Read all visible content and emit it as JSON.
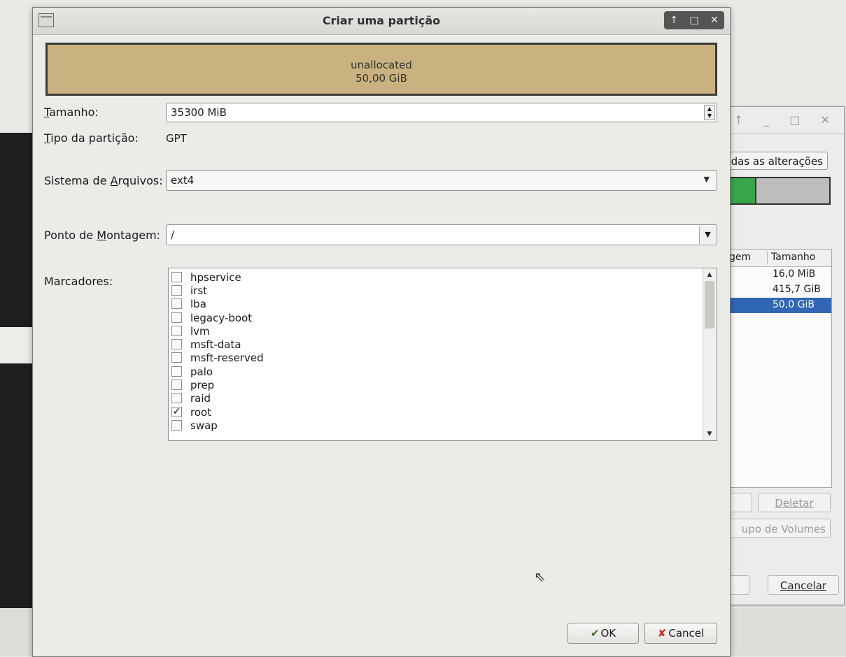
{
  "background_window": {
    "apply_all_label": "odas as alterações",
    "table_headers": [
      "gem",
      "Tamanho"
    ],
    "rows": [
      {
        "size": "16,0 MiB",
        "selected": false
      },
      {
        "size": "415,7 GiB",
        "selected": false
      },
      {
        "size": "50,0 GiB",
        "selected": true
      }
    ],
    "delete_label": "Deletar",
    "volume_group_label": "upo de Volumes",
    "cancel_label": "Cancelar"
  },
  "dialog": {
    "title": "Criar uma partição",
    "partition_bar": {
      "line1": "unallocated",
      "line2": "50,00 GiB",
      "color": "#c9b27f"
    },
    "size": {
      "label_mnemonic": "T",
      "label_rest": "amanho:",
      "value": "35300 MiB"
    },
    "partition_type": {
      "label_mnemonic": "T",
      "label_rest": "ipo da partição:",
      "value": "GPT"
    },
    "filesystem": {
      "label_pre": "Sistema de ",
      "label_mnemonic": "A",
      "label_rest": "rquivos:",
      "value": "ext4"
    },
    "mount_point": {
      "label_pre": "Ponto de ",
      "label_mnemonic": "M",
      "label_rest": "ontagem:",
      "value": "/"
    },
    "flags_label": "Marcadores:",
    "flags": [
      {
        "name": "hpservice",
        "checked": false
      },
      {
        "name": "irst",
        "checked": false
      },
      {
        "name": "lba",
        "checked": false
      },
      {
        "name": "legacy-boot",
        "checked": false
      },
      {
        "name": "lvm",
        "checked": false
      },
      {
        "name": "msft-data",
        "checked": false
      },
      {
        "name": "msft-reserved",
        "checked": false
      },
      {
        "name": "palo",
        "checked": false
      },
      {
        "name": "prep",
        "checked": false
      },
      {
        "name": "raid",
        "checked": false
      },
      {
        "name": "root",
        "checked": true
      },
      {
        "name": "swap",
        "checked": false
      }
    ],
    "ok_label": "OK",
    "cancel_label": "Cancel"
  }
}
